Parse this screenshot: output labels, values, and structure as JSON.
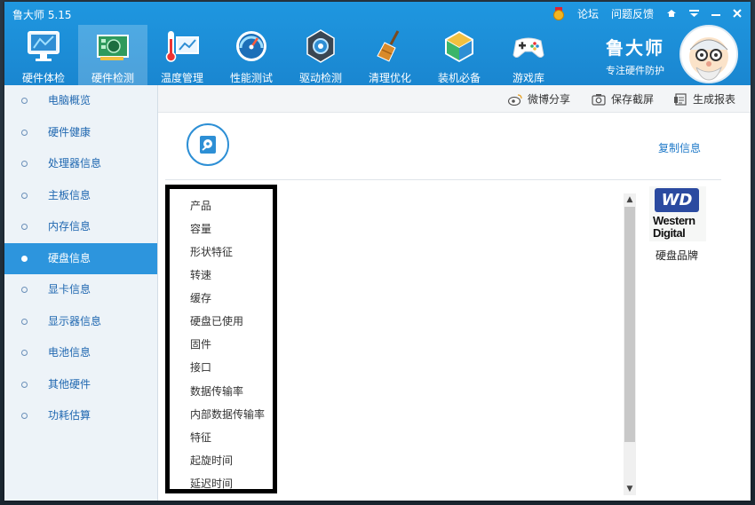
{
  "app": {
    "title": "鲁大师 5.15"
  },
  "top_links": {
    "forum": "论坛",
    "feedback": "问题反馈"
  },
  "nav": [
    {
      "label": "硬件体检",
      "icon": "monitor-icon"
    },
    {
      "label": "硬件检测",
      "icon": "hardware-card-icon",
      "active": true
    },
    {
      "label": "温度管理",
      "icon": "thermometer-icon"
    },
    {
      "label": "性能测试",
      "icon": "speedometer-icon"
    },
    {
      "label": "驱动检测",
      "icon": "driver-gear-icon"
    },
    {
      "label": "清理优化",
      "icon": "broom-icon"
    },
    {
      "label": "装机必备",
      "icon": "box-icon"
    },
    {
      "label": "游戏库",
      "icon": "gamepad-icon"
    }
  ],
  "brand": {
    "name": "鲁大师",
    "slogan": "专注硬件防护"
  },
  "sidebar": {
    "items": [
      {
        "label": "电脑概览"
      },
      {
        "label": "硬件健康"
      },
      {
        "label": "处理器信息"
      },
      {
        "label": "主板信息"
      },
      {
        "label": "内存信息"
      },
      {
        "label": "硬盘信息",
        "active": true
      },
      {
        "label": "显卡信息"
      },
      {
        "label": "显示器信息"
      },
      {
        "label": "电池信息"
      },
      {
        "label": "其他硬件"
      },
      {
        "label": "功耗估算"
      }
    ]
  },
  "toolbar": {
    "share": "微博分享",
    "screenshot": "保存截屏",
    "report": "生成报表"
  },
  "main": {
    "copy_label": "复制信息",
    "fields": [
      "产品",
      "容量",
      "形状特征",
      "转速",
      "缓存",
      "硬盘已使用",
      "固件",
      "接口",
      "数据传输率",
      "内部数据传输率",
      "特征",
      "起旋时间",
      "延迟时间"
    ],
    "brand_logo": {
      "badge": "WD",
      "line1": "Western",
      "line2": "Digital"
    },
    "brand_caption": "硬盘品牌"
  },
  "colors": {
    "header": "#1f97e0",
    "accent": "#2d95dd",
    "link": "#1f79c8",
    "sidebar": "#edf3f8"
  }
}
